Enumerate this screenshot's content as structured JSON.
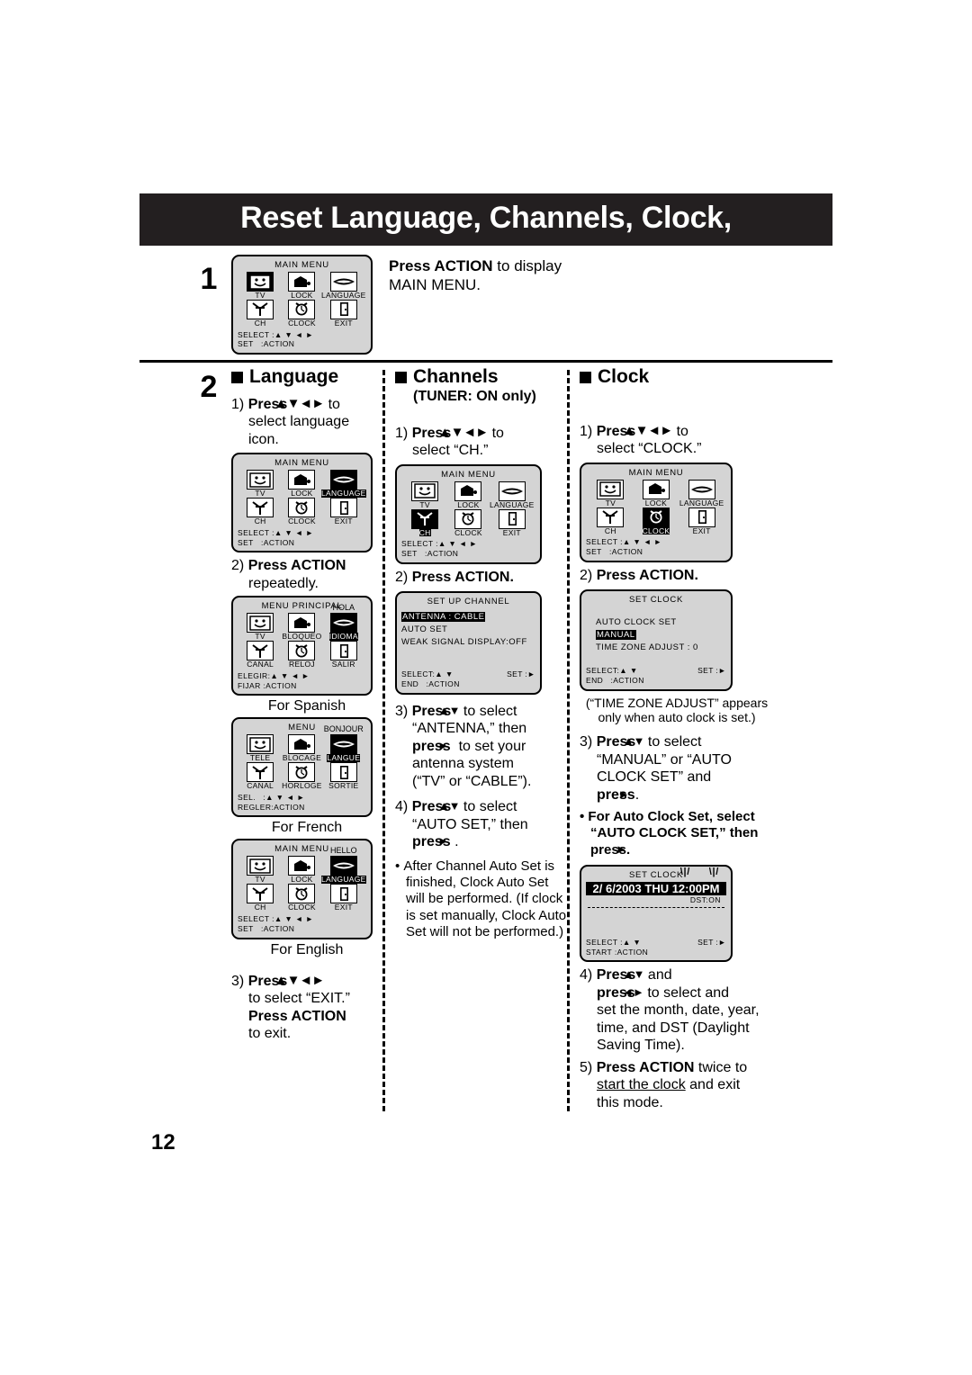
{
  "banner": {
    "title": "Reset Language, Channels, Clock,"
  },
  "page_number": "12",
  "step1": {
    "number": "1",
    "text_bold": "Press ACTION",
    "text_rest": " to display",
    "text_line2": "MAIN MENU.",
    "osd": {
      "title": "MAIN MENU",
      "cells": [
        {
          "label": "TV",
          "icon": "tv-icon",
          "selected": true
        },
        {
          "label": "LOCK",
          "icon": "lock-icon",
          "selected": false
        },
        {
          "label": "LANGUAGE",
          "icon": "language-icon",
          "selected": false
        },
        {
          "label": "CH",
          "icon": "antenna-icon",
          "selected": false
        },
        {
          "label": "CLOCK",
          "icon": "clock-icon",
          "selected": false
        },
        {
          "label": "EXIT",
          "icon": "exit-door-icon",
          "selected": false
        }
      ],
      "foot_left_1": "SELECT :",
      "foot_arrows_1": "▲ ▼ ◄ ►",
      "foot_left_2": "SET",
      "foot_right_2": ":ACTION"
    }
  },
  "step2": {
    "number": "2",
    "language": {
      "heading": "Language",
      "s1": {
        "num": "1)",
        "bold": "Press",
        "arrows": "▲▼◄►",
        "rest": " to",
        "line2": "select language",
        "line3": "icon."
      },
      "osd1": {
        "title": "MAIN MENU",
        "greeting": "",
        "cells": [
          {
            "label": "TV",
            "icon": "tv-icon",
            "selected": false
          },
          {
            "label": "LOCK",
            "icon": "lock-icon",
            "selected": false
          },
          {
            "label": "LANGUAGE",
            "icon": "language-icon",
            "selected": true
          },
          {
            "label": "CH",
            "icon": "antenna-icon",
            "selected": false
          },
          {
            "label": "CLOCK",
            "icon": "clock-icon",
            "selected": false
          },
          {
            "label": "EXIT",
            "icon": "exit-door-icon",
            "selected": false
          }
        ],
        "foot_left_1": "SELECT :",
        "foot_arrows_1": "▲ ▼ ◄ ►",
        "foot_left_2": "SET",
        "foot_right_2": ":ACTION"
      },
      "s2": {
        "num": "2)",
        "bold": "Press ACTION",
        "line2": "repeatedly."
      },
      "osd_spanish": {
        "title": "MENU PRINCIPAL",
        "greeting": "HOLA",
        "cells": [
          {
            "label": "TV",
            "icon": "tv-icon",
            "selected": false
          },
          {
            "label": "BLOQUEO",
            "icon": "lock-icon",
            "selected": false
          },
          {
            "label": "IDIOMA",
            "icon": "language-icon",
            "selected": true
          },
          {
            "label": "CANAL",
            "icon": "antenna-icon",
            "selected": false
          },
          {
            "label": "RELOJ",
            "icon": "clock-icon",
            "selected": false
          },
          {
            "label": "SALIR",
            "icon": "exit-door-icon",
            "selected": false
          }
        ],
        "foot_left_1": "ELEGIR:",
        "foot_arrows_1": "▲ ▼ ◄ ►",
        "foot_left_2": "FIJAR",
        "foot_right_2": ":ACTION"
      },
      "caption_spanish": "For Spanish",
      "osd_french": {
        "title": "MENU",
        "greeting": "BONJOUR",
        "cells": [
          {
            "label": "TELE",
            "icon": "tv-icon",
            "selected": false
          },
          {
            "label": "BLOCAGE",
            "icon": "lock-icon",
            "selected": false
          },
          {
            "label": "LANGUE",
            "icon": "language-icon",
            "selected": true
          },
          {
            "label": "CANAL",
            "icon": "antenna-icon",
            "selected": false
          },
          {
            "label": "HORLOGE",
            "icon": "clock-icon",
            "selected": false
          },
          {
            "label": "SORTIE",
            "icon": "exit-door-icon",
            "selected": false
          }
        ],
        "foot_left_1": "SEL.",
        "foot_arrows_1": ":▲ ▼ ◄ ►",
        "foot_left_2": "REGLER",
        "foot_right_2": ":ACTION"
      },
      "caption_french": "For French",
      "osd_english": {
        "title": "MAIN MENU",
        "greeting": "HELLO",
        "cells": [
          {
            "label": "TV",
            "icon": "tv-icon",
            "selected": false
          },
          {
            "label": "LOCK",
            "icon": "lock-icon",
            "selected": false
          },
          {
            "label": "LANGUAGE",
            "icon": "language-icon",
            "selected": true
          },
          {
            "label": "CH",
            "icon": "antenna-icon",
            "selected": false
          },
          {
            "label": "CLOCK",
            "icon": "clock-icon",
            "selected": false
          },
          {
            "label": "EXIT",
            "icon": "exit-door-icon",
            "selected": false
          }
        ],
        "foot_left_1": "SELECT :",
        "foot_arrows_1": "▲ ▼ ◄ ►",
        "foot_left_2": "SET",
        "foot_right_2": ":ACTION"
      },
      "caption_english": "For English",
      "s3": {
        "num": "3)",
        "bold": "Press",
        "arrows": "▲▼◄►",
        "line2": "to select “EXIT.”",
        "bold2": "Press ACTION",
        "line4": "to exit."
      }
    },
    "channels": {
      "heading": "Channels",
      "subheading": "(TUNER: ON only)",
      "s1": {
        "num": "1)",
        "bold": "Press",
        "arrows": "▲▼◄►",
        "rest": " to",
        "line2": "select “CH.”"
      },
      "osd1": {
        "title": "MAIN MENU",
        "cells": [
          {
            "label": "TV",
            "icon": "tv-icon",
            "selected": false
          },
          {
            "label": "LOCK",
            "icon": "lock-icon",
            "selected": false
          },
          {
            "label": "LANGUAGE",
            "icon": "language-icon",
            "selected": false
          },
          {
            "label": "CH",
            "icon": "antenna-icon",
            "selected": true
          },
          {
            "label": "CLOCK",
            "icon": "clock-icon",
            "selected": false
          },
          {
            "label": "EXIT",
            "icon": "exit-door-icon",
            "selected": false
          }
        ],
        "foot_left_1": "SELECT :",
        "foot_arrows_1": "▲ ▼ ◄ ►",
        "foot_left_2": "SET",
        "foot_right_2": ":ACTION"
      },
      "s2": {
        "num": "2)",
        "bold": "Press ACTION."
      },
      "osd_setup": {
        "title": "SET UP CHANNEL",
        "rows": [
          {
            "text": "ANTENNA : CABLE",
            "highlighted": true
          },
          {
            "text": "AUTO SET",
            "highlighted": false
          },
          {
            "text": "WEAK SIGNAL DISPLAY:OFF",
            "highlighted": false
          }
        ],
        "foot_left_1": "SELECT:",
        "foot_arrows_1": "▲ ▼",
        "foot_right_1": "SET :►",
        "foot_left_2": "END",
        "foot_right_2": ":ACTION"
      },
      "s3": {
        "num": "3)",
        "bold": "Press",
        "arrows": "▲▼",
        "rest": " to select",
        "line2": "“ANTENNA,” then",
        "bold2": "press",
        "arrow2": "►",
        "rest2": " to set your",
        "line4": "antenna system",
        "line5": "(“TV” or “CABLE”)."
      },
      "s4": {
        "num": "4)",
        "bold": "Press",
        "arrows": "▲▼",
        "rest": " to select",
        "line2": "“AUTO SET,” then",
        "bold2": "press",
        "arrow2": "►",
        "rest2": "."
      },
      "bullet": "After Channel Auto Set is finished, Clock Auto Set will be performed. (If clock is set manually, Clock Auto Set will not be performed.)"
    },
    "clock": {
      "heading": "Clock",
      "s1": {
        "num": "1)",
        "bold": "Press",
        "arrows": "▲▼◄►",
        "rest": " to",
        "line2": "select “CLOCK.”"
      },
      "osd1": {
        "title": "MAIN MENU",
        "cells": [
          {
            "label": "TV",
            "icon": "tv-icon",
            "selected": false
          },
          {
            "label": "LOCK",
            "icon": "lock-icon",
            "selected": false
          },
          {
            "label": "LANGUAGE",
            "icon": "language-icon",
            "selected": false
          },
          {
            "label": "CH",
            "icon": "antenna-icon",
            "selected": false
          },
          {
            "label": "CLOCK",
            "icon": "clock-icon",
            "selected": true
          },
          {
            "label": "EXIT",
            "icon": "exit-door-icon",
            "selected": false
          }
        ],
        "foot_left_1": "SELECT :",
        "foot_arrows_1": "▲ ▼ ◄ ►",
        "foot_left_2": "SET",
        "foot_right_2": ":ACTION"
      },
      "s2": {
        "num": "2)",
        "bold": "Press ACTION."
      },
      "osd_setclock": {
        "title": "SET CLOCK",
        "rows": [
          {
            "text": "AUTO CLOCK SET",
            "highlighted": false
          },
          {
            "text": "MANUAL",
            "highlighted": true
          },
          {
            "text": "TIME ZONE ADJUST : 0",
            "highlighted": false
          }
        ],
        "foot_left_1": "SELECT:",
        "foot_arrows_1": "▲ ▼",
        "foot_right_1": "SET :►",
        "foot_left_2": "END",
        "foot_right_2": ":ACTION"
      },
      "note1": "(“TIME ZONE ADJUST” appears only when auto clock is set.)",
      "s3": {
        "num": "3)",
        "bold": "Press",
        "arrows": "▲▼",
        "rest": " to select",
        "line2": "“MANUAL” or “AUTO",
        "line3": "CLOCK SET” and",
        "bold2": "press",
        "arrow2": "►",
        "rest2": "."
      },
      "bullet": {
        "bold": "For Auto Clock Set, select “AUTO CLOCK SET,” then press",
        "arrow": "►",
        "end": "."
      },
      "osd_clockdisplay": {
        "title": "SET CLOCK",
        "value": "2/ 6/2003 THU  12:00PM",
        "dst": "DST:ON",
        "foot_left_1": "SELECT :",
        "foot_arrows_1": "▲ ▼",
        "foot_right_1": "SET :►",
        "foot_left_2": "START",
        "foot_right_2": ":ACTION"
      },
      "s4": {
        "num": "4)",
        "bold": "Press",
        "arrows": "▲▼",
        "rest": " and",
        "bold2": "press",
        "arrows2": "◄►",
        "rest2": " to select and",
        "line3": "set the month, date, year,",
        "line4": "time, and DST (Daylight",
        "line5": "Saving Time)."
      },
      "s5": {
        "num": "5)",
        "bold": "Press ACTION",
        "rest": " twice to",
        "underline": "start the clock",
        "rest2": " and exit",
        "line3": "this mode."
      }
    }
  }
}
